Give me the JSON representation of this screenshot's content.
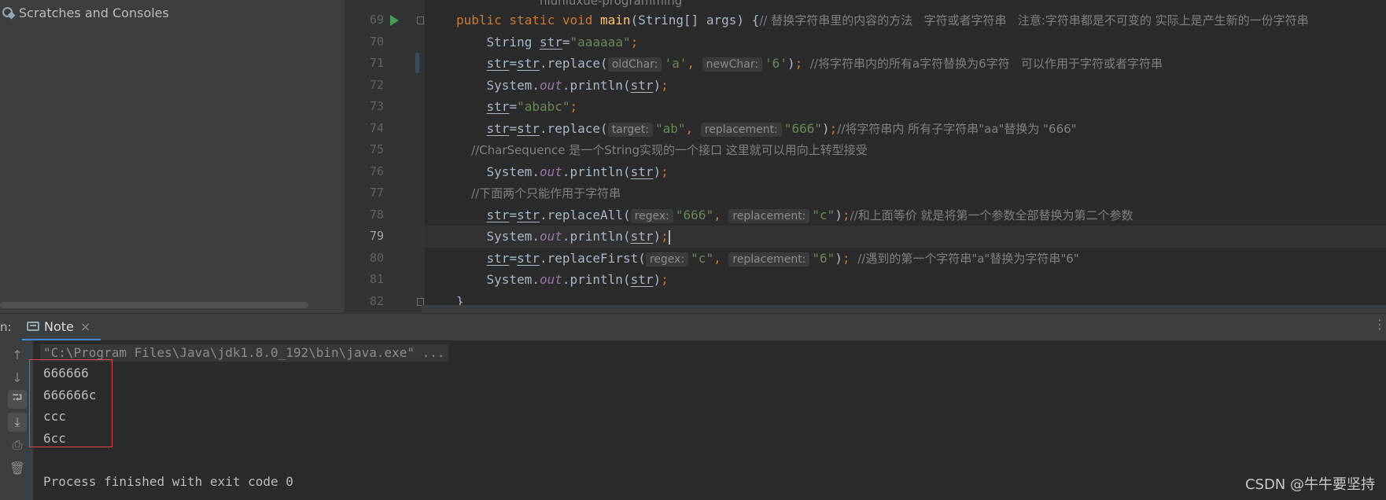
{
  "project": {
    "item_label": "Scratches and Consoles"
  },
  "editor": {
    "breadcrumb": "niuniuxue-programming",
    "lines": [
      {
        "num": "69",
        "tokens": [
          {
            "c": "kw",
            "t": "public static void "
          },
          {
            "c": "fn",
            "t": "main"
          },
          {
            "c": "",
            "t": "(String[] args) {"
          },
          {
            "c": "cm",
            "t": "// 替换字符串里的内容的方法   字符或者字符串   注意:字符串都是不可变的 实际上是产生新的一份字符串"
          }
        ]
      },
      {
        "num": "70",
        "tokens": [
          {
            "c": "",
            "t": "    String "
          },
          {
            "c": "var",
            "t": "str"
          },
          {
            "c": "",
            "t": "="
          },
          {
            "c": "str",
            "t": "\"aaaaaa\""
          },
          {
            "c": "kw",
            "t": ";"
          }
        ]
      },
      {
        "num": "71",
        "tokens": [
          {
            "c": "",
            "t": "    "
          },
          {
            "c": "var",
            "t": "str"
          },
          {
            "c": "",
            "t": "="
          },
          {
            "c": "var",
            "t": "str"
          },
          {
            "c": "",
            "t": ".replace("
          },
          {
            "c": "hint",
            "t": "oldChar:"
          },
          {
            "c": "str",
            "t": "'a'"
          },
          {
            "c": "kw",
            "t": ", "
          },
          {
            "c": "hint",
            "t": "newChar:"
          },
          {
            "c": "str",
            "t": "'6'"
          },
          {
            "c": "",
            "t": ")"
          },
          {
            "c": "kw",
            "t": "; "
          },
          {
            "c": "cm",
            "t": "//将字符串内的所有a字符替换为6字符   可以作用于字符或者字符串"
          }
        ]
      },
      {
        "num": "72",
        "tokens": [
          {
            "c": "",
            "t": "    System."
          },
          {
            "c": "field",
            "t": "out"
          },
          {
            "c": "",
            "t": ".println("
          },
          {
            "c": "var",
            "t": "str"
          },
          {
            "c": "",
            "t": ")"
          },
          {
            "c": "kw",
            "t": ";"
          }
        ]
      },
      {
        "num": "73",
        "tokens": [
          {
            "c": "",
            "t": "    "
          },
          {
            "c": "var",
            "t": "str"
          },
          {
            "c": "",
            "t": "="
          },
          {
            "c": "str",
            "t": "\"ababc\""
          },
          {
            "c": "kw",
            "t": ";"
          }
        ]
      },
      {
        "num": "74",
        "tokens": [
          {
            "c": "",
            "t": "    "
          },
          {
            "c": "var",
            "t": "str"
          },
          {
            "c": "",
            "t": "="
          },
          {
            "c": "var",
            "t": "str"
          },
          {
            "c": "",
            "t": ".replace("
          },
          {
            "c": "hint",
            "t": "target:"
          },
          {
            "c": "str",
            "t": "\"ab\""
          },
          {
            "c": "kw",
            "t": ", "
          },
          {
            "c": "hint",
            "t": "replacement:"
          },
          {
            "c": "str",
            "t": "\"666\""
          },
          {
            "c": "",
            "t": ")"
          },
          {
            "c": "kw",
            "t": ";"
          },
          {
            "c": "cm",
            "t": "//将字符串内 所有子字符串\"aa\"替换为 \"666\""
          }
        ]
      },
      {
        "num": "75",
        "tokens": [
          {
            "c": "cm",
            "t": "    //CharSequence 是一个String实现的一个接口 这里就可以用向上转型接受"
          }
        ]
      },
      {
        "num": "76",
        "tokens": [
          {
            "c": "",
            "t": "    System."
          },
          {
            "c": "field",
            "t": "out"
          },
          {
            "c": "",
            "t": ".println("
          },
          {
            "c": "var",
            "t": "str"
          },
          {
            "c": "",
            "t": ")"
          },
          {
            "c": "kw",
            "t": ";"
          }
        ]
      },
      {
        "num": "77",
        "tokens": [
          {
            "c": "cm",
            "t": "    //下面两个只能作用于字符串"
          }
        ]
      },
      {
        "num": "78",
        "tokens": [
          {
            "c": "",
            "t": "    "
          },
          {
            "c": "var",
            "t": "str"
          },
          {
            "c": "",
            "t": "="
          },
          {
            "c": "var",
            "t": "str"
          },
          {
            "c": "",
            "t": ".replaceAll("
          },
          {
            "c": "hint",
            "t": "regex:"
          },
          {
            "c": "str",
            "t": "\"666\""
          },
          {
            "c": "kw",
            "t": ", "
          },
          {
            "c": "hint",
            "t": "replacement:"
          },
          {
            "c": "str",
            "t": "\"c\""
          },
          {
            "c": "",
            "t": ")"
          },
          {
            "c": "kw",
            "t": ";"
          },
          {
            "c": "cm",
            "t": "//和上面等价 就是将第一个参数全部替换为第二个参数"
          }
        ]
      },
      {
        "num": "79",
        "tokens": [
          {
            "c": "",
            "t": "    System."
          },
          {
            "c": "field",
            "t": "out"
          },
          {
            "c": "",
            "t": ".println("
          },
          {
            "c": "var",
            "t": "str"
          },
          {
            "c": "",
            "t": ")"
          },
          {
            "c": "kw",
            "t": ";"
          },
          {
            "c": "caret",
            "t": ""
          }
        ]
      },
      {
        "num": "80",
        "tokens": [
          {
            "c": "",
            "t": "    "
          },
          {
            "c": "var",
            "t": "str"
          },
          {
            "c": "",
            "t": "="
          },
          {
            "c": "var",
            "t": "str"
          },
          {
            "c": "",
            "t": ".replaceFirst("
          },
          {
            "c": "hint",
            "t": "regex:"
          },
          {
            "c": "str",
            "t": "\"c\""
          },
          {
            "c": "kw",
            "t": ", "
          },
          {
            "c": "hint",
            "t": "replacement:"
          },
          {
            "c": "str",
            "t": "\"6\""
          },
          {
            "c": "",
            "t": ")"
          },
          {
            "c": "kw",
            "t": "; "
          },
          {
            "c": "cm",
            "t": "//遇到的第一个字符串\"a\"替换为字符串\"6\""
          }
        ]
      },
      {
        "num": "81",
        "tokens": [
          {
            "c": "",
            "t": "    System."
          },
          {
            "c": "field",
            "t": "out"
          },
          {
            "c": "",
            "t": ".println("
          },
          {
            "c": "var",
            "t": "str"
          },
          {
            "c": "",
            "t": ")"
          },
          {
            "c": "kw",
            "t": ";"
          }
        ]
      },
      {
        "num": "82",
        "tokens": [
          {
            "c": "",
            "t": "}"
          }
        ]
      }
    ]
  },
  "run": {
    "label": "n:",
    "tab_label": "Note",
    "command": "\"C:\\Program Files\\Java\\jdk1.8.0_192\\bin\\java.exe\" ...",
    "output": [
      "666666",
      "666666c",
      "ccc",
      "6cc"
    ],
    "exit_message": "Process finished with exit code 0"
  },
  "watermark": "CSDN @牛牛要坚持"
}
